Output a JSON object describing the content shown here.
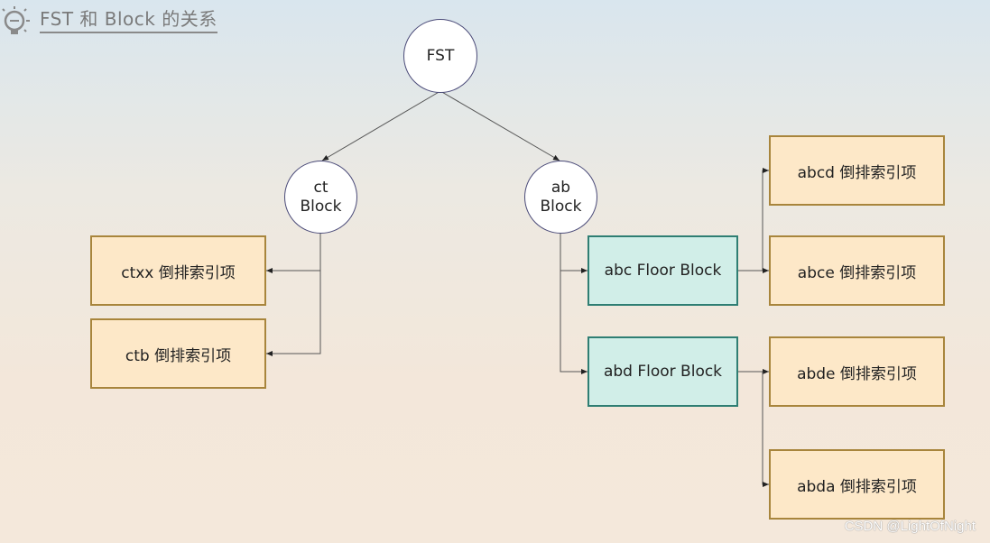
{
  "header": {
    "icon": "lightbulb-icon",
    "title": "FST 和 Block 的关系"
  },
  "nodes": {
    "root": "FST",
    "ct_block_line1": "ct",
    "ct_block_line2": "Block",
    "ab_block_line1": "ab",
    "ab_block_line2": "Block",
    "ctxx": "ctxx 倒排索引项",
    "ctb": "ctb 倒排索引项",
    "abc_floor": "abc Floor Block",
    "abd_floor": "abd Floor Block",
    "abcd": "abcd 倒排索引项",
    "abce": "abce 倒排索引项",
    "abde": "abde 倒排索引项",
    "abda": "abda 倒排索引项"
  },
  "edges": [
    {
      "from": "FST",
      "to": "ct Block"
    },
    {
      "from": "FST",
      "to": "ab Block"
    },
    {
      "from": "ct Block",
      "to": "ctxx 倒排索引项"
    },
    {
      "from": "ct Block",
      "to": "ctb 倒排索引项"
    },
    {
      "from": "ab Block",
      "to": "abc Floor Block"
    },
    {
      "from": "ab Block",
      "to": "abd Floor Block"
    },
    {
      "from": "abc Floor Block",
      "to": "abcd 倒排索引项"
    },
    {
      "from": "abc Floor Block",
      "to": "abce 倒排索引项"
    },
    {
      "from": "abd Floor Block",
      "to": "abde 倒排索引项"
    },
    {
      "from": "abd Floor Block",
      "to": "abda 倒排索引项"
    }
  ],
  "colors": {
    "leaf_fill": "#fde8c8",
    "leaf_border": "#a8853c",
    "floor_fill": "#d1eee8",
    "floor_border": "#2f7e73",
    "circle_border": "#4a4a78"
  },
  "watermark": "CSDN @LightOfNight"
}
